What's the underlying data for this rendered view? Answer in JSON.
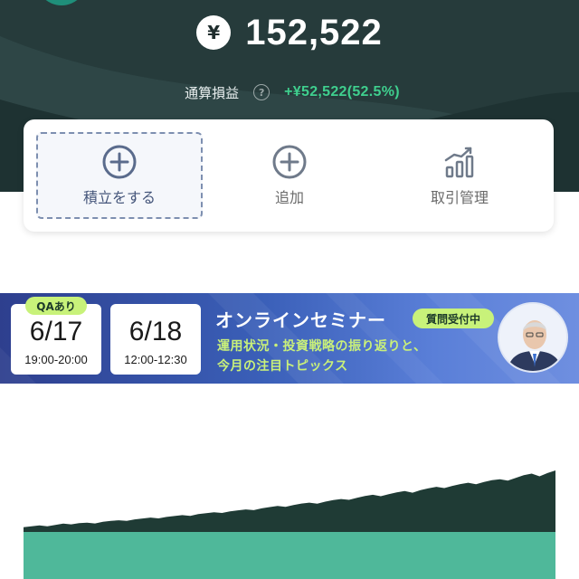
{
  "portfolio": {
    "currency_symbol": "¥",
    "total_value": "152,522",
    "pl_label": "通算損益",
    "pl_value": "+¥52,522(52.5%)"
  },
  "actions": [
    {
      "label": "積立をする",
      "icon": "plus-circle-icon"
    },
    {
      "label": "追加",
      "icon": "plus-circle-icon"
    },
    {
      "label": "取引管理",
      "icon": "bar-chart-trend-icon"
    }
  ],
  "banner": {
    "qa_badge": "QAあり",
    "date1": "6/17",
    "time1": "19:00-20:00",
    "date2": "6/18",
    "time2": "12:00-12:30",
    "title": "オンラインセミナー",
    "badge": "質問受付中",
    "subtitle_line1": "運用状況・投資戦略の振り返りと、",
    "subtitle_line2": "今月の注目トピックス"
  },
  "colors": {
    "header_bg": "#263b3b",
    "positive": "#3fcf8e",
    "accent_blue": "#5a6b8c",
    "chart_dark": "#1f3b35",
    "chart_teal": "#4fb89a"
  },
  "chart_data": {
    "type": "area",
    "series": [
      {
        "values": [
          4.2,
          5.1,
          5.8,
          5.0,
          6.2,
          7.4,
          6.8,
          7.9,
          8.3,
          7.6,
          9.1,
          9.9,
          10.4,
          9.8,
          11.2,
          12.0,
          12.8,
          12.1,
          13.4,
          14.2,
          15.0,
          14.3,
          15.9,
          16.8,
          17.5,
          16.9,
          18.4,
          19.3,
          20.1,
          19.4,
          21.0,
          22.2,
          23.1,
          22.4,
          24.0,
          25.3,
          26.1,
          25.2,
          27.0,
          28.4,
          29.3,
          28.6,
          30.5,
          32.0,
          33.1,
          31.8,
          33.6,
          35.2,
          36.4,
          35.0,
          37.3,
          38.9,
          40.2,
          39.1,
          41.0,
          42.6,
          43.8,
          42.5,
          44.6,
          46.1,
          47.0,
          45.8,
          48.2,
          50.5,
          52.0,
          49.6,
          52.5,
          54.8
        ]
      }
    ],
    "base_values": 100
  }
}
